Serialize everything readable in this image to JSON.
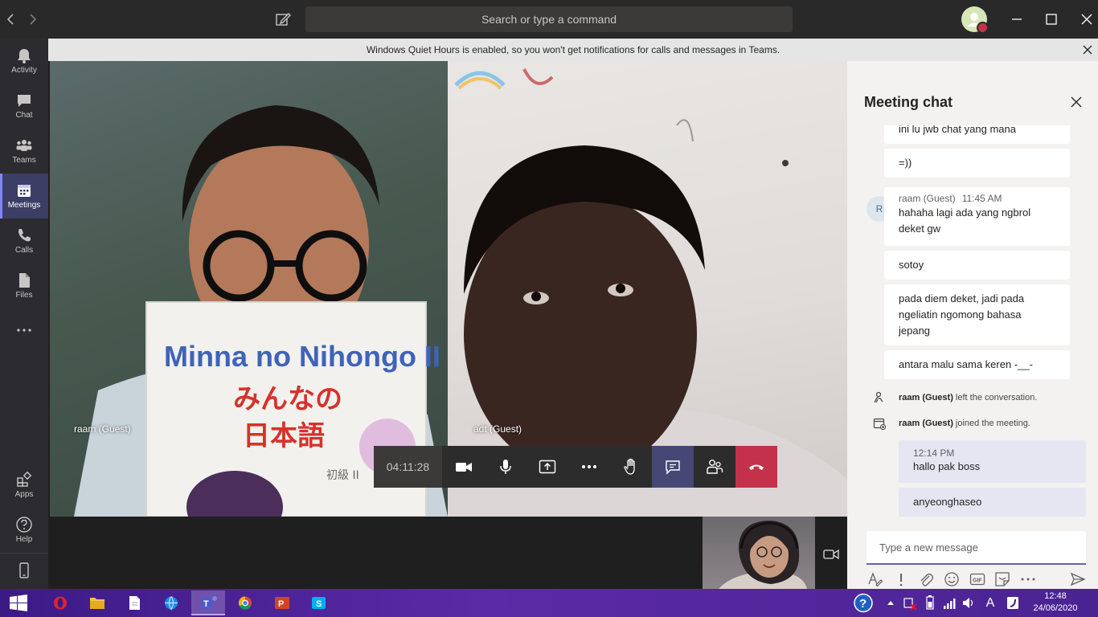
{
  "titlebar": {
    "search_placeholder": "Search or type a command"
  },
  "rail": {
    "items": [
      {
        "label": "Activity"
      },
      {
        "label": "Chat"
      },
      {
        "label": "Teams"
      },
      {
        "label": "Meetings"
      },
      {
        "label": "Calls"
      },
      {
        "label": "Files"
      },
      {
        "label": "Apps"
      },
      {
        "label": "Help"
      }
    ],
    "active": "Meetings"
  },
  "banner": {
    "text": "Windows Quiet Hours is enabled, so you won't get notifications for calls and messages in Teams."
  },
  "stage": {
    "participants": [
      {
        "name": "raam (Guest)"
      },
      {
        "name": "adt (Guest)"
      }
    ],
    "book_title": "Minna no Nihongo II",
    "book_subtitle_1": "みんなの",
    "book_subtitle_2": "日本語",
    "book_corner": "初級 II"
  },
  "controls": {
    "timer": "04:11:28"
  },
  "chat": {
    "title": "Meeting chat",
    "messages": [
      {
        "text": "ini lu jwb chat yang mana"
      },
      {
        "text": "=))"
      },
      {
        "author": "raam (Guest)",
        "time": "11:45 AM",
        "avatar_initial": "R",
        "text": "hahaha lagi ada yang ngbrol deket gw"
      },
      {
        "text": "sotoy"
      },
      {
        "text": "pada diem deket, jadi pada ngeliatin ngomong bahasa jepang"
      },
      {
        "text": "antara malu sama keren -__-"
      }
    ],
    "system": [
      {
        "who": "raam (Guest)",
        "action": " left the conversation."
      },
      {
        "who": "raam (Guest)",
        "action": " joined the meeting."
      }
    ],
    "mine": [
      {
        "time": "12:14 PM",
        "text": "hallo pak boss"
      },
      {
        "text": "anyeonghaseo"
      }
    ],
    "compose_placeholder": "Type a new message"
  },
  "taskbar": {
    "time": "12:48",
    "date": "24/06/2020",
    "lang": "A"
  },
  "colors": {
    "accent": "#6264a7",
    "hangup": "#c4314b",
    "rail_active": "#3d3e66"
  }
}
